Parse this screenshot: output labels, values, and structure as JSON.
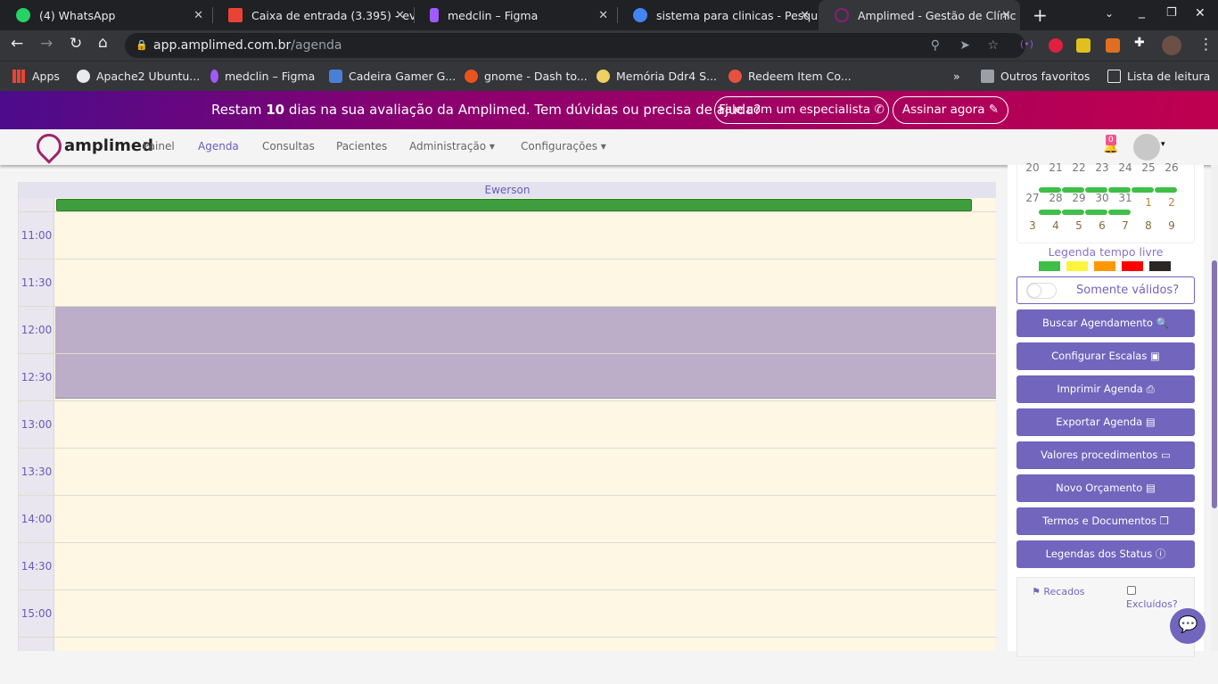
{
  "browser": {
    "tabs": [
      {
        "title": "(4) WhatsApp",
        "color": "#25d366"
      },
      {
        "title": "Caixa de entrada (3.395) - ev",
        "color": "#ea4335"
      },
      {
        "title": "medclin – Figma",
        "color": "#a259ff"
      },
      {
        "title": "sistema para clinicas - Pesqu",
        "color": "#4285f4"
      },
      {
        "title": "Amplimed - Gestão de Clínic",
        "color": "#8a1c7c",
        "active": true
      }
    ],
    "url_host": "app.amplimed.com.br",
    "url_path": "/agenda",
    "bookmarks": [
      {
        "label": "Apps",
        "color": "#ea4335"
      },
      {
        "label": "Apache2 Ubuntu...",
        "color": "#e8eaed"
      },
      {
        "label": "medclin – Figma",
        "color": "#a259ff"
      },
      {
        "label": "Cadeira Gamer G...",
        "color": "#4a7fd6"
      },
      {
        "label": "gnome - Dash to...",
        "color": "#e8541c"
      },
      {
        "label": "Memória Ddr4 S...",
        "color": "#f0d060"
      },
      {
        "label": "Redeem Item Co...",
        "color": "#e85040"
      }
    ],
    "more": "»",
    "other_favorites": "Outros favoritos",
    "reading_list": "Lista de leitura"
  },
  "banner": {
    "prefix": "Restam ",
    "days": "10",
    "suffix": " dias na sua avaliação da Amplimed. Tem dúvidas ou precisa de ajuda?",
    "specialist": "Fale com um especialista ✆",
    "subscribe": "Assinar agora ✎"
  },
  "nav": {
    "logo": "amplimed",
    "items": [
      "Painel",
      "Agenda",
      "Consultas",
      "Pacientes",
      "Administração ▾",
      "Configurações ▾"
    ],
    "active": "Agenda",
    "notif_count": "0"
  },
  "calendar": {
    "professional": "Ewerson",
    "times": [
      "11:00",
      "11:30",
      "12:00",
      "12:30",
      "13:00",
      "13:30",
      "14:00",
      "14:30",
      "15:00"
    ]
  },
  "mini_calendar": {
    "rows": [
      [
        "20",
        "21",
        "22",
        "23",
        "24",
        "25",
        "26"
      ],
      [
        "27",
        "28",
        "29",
        "30",
        "31",
        "1",
        "2"
      ],
      [
        "3",
        "4",
        "5",
        "6",
        "7",
        "8",
        "9"
      ]
    ]
  },
  "legend": {
    "title": "Legenda tempo livre",
    "colors": [
      "#3fbf48",
      "#fff33b",
      "#ff9800",
      "#ff0000",
      "#2a2626"
    ]
  },
  "toggle_label": "Somente válidos?",
  "buttons": [
    "Buscar Agendamento 🔍",
    "Configurar Escalas ▣",
    "Imprimir Agenda ⎙",
    "Exportar Agenda ▤",
    "Valores procedimentos ▭",
    "Novo Orçamento ▤",
    "Termos e Documentos ❐",
    "Legendas dos Status ⓘ"
  ],
  "recados": {
    "label": "Recados",
    "excluded": "Excluídos?"
  },
  "colors": {
    "accent": "#7265bd",
    "free_slot": "#fdf7e3",
    "blocked": "#bcaec8",
    "booked": "#3e9e3e"
  }
}
